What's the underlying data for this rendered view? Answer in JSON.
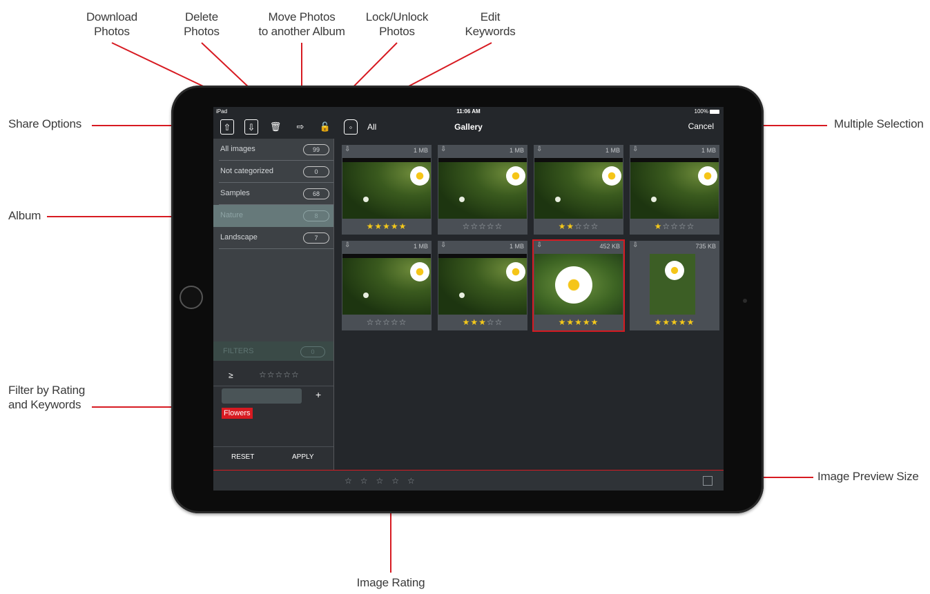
{
  "callouts": {
    "download": "Download\nPhotos",
    "delete": "Delete\nPhotos",
    "move": "Move Photos\nto another Album",
    "lock": "Lock/Unlock\nPhotos",
    "keywords": "Edit\nKeywords",
    "share": "Share Options",
    "album": "Album",
    "filter": "Filter by Rating\nand Keywords",
    "multiple": "Multiple Selection",
    "preview_size": "Image Preview Size",
    "rating": "Image Rating"
  },
  "colors": {
    "accent": "#d71a21",
    "star": "#f4c81b",
    "sidebar": "#3d4145",
    "screen": "#24272b"
  },
  "status": {
    "device": "iPad",
    "time": "11:06 AM",
    "battery": "100%"
  },
  "toolbar": {
    "icons": [
      "share-icon",
      "download-icon",
      "trash-icon",
      "move-arrow-icon",
      "lock-icon",
      "tag-icon"
    ],
    "all_label": "All",
    "title": "Gallery",
    "cancel_label": "Cancel"
  },
  "albums": [
    {
      "name": "All images",
      "count": "99"
    },
    {
      "name": "Not categorized",
      "count": "0"
    },
    {
      "name": "Samples",
      "count": "68"
    },
    {
      "name": "Nature",
      "count": "8",
      "selected": true
    },
    {
      "name": "Landscape",
      "count": "7"
    }
  ],
  "filters": {
    "title": "FILTERS",
    "count": "0",
    "operator": "≥",
    "rating_stars": "☆☆☆☆☆",
    "add_label": "+",
    "keyword_tag": "Flowers",
    "reset_label": "RESET",
    "apply_label": "APPLY"
  },
  "photos": [
    {
      "size": "1 MB",
      "rating": 5
    },
    {
      "size": "1 MB",
      "rating": 0
    },
    {
      "size": "1 MB",
      "rating": 2
    },
    {
      "size": "1 MB",
      "rating": 1
    },
    {
      "size": "1 MB",
      "rating": 0
    },
    {
      "size": "1 MB",
      "rating": 3
    },
    {
      "size": "452 KB",
      "rating": 5,
      "selected": true
    },
    {
      "size": "735 KB",
      "rating": 5
    }
  ],
  "bottombar": {
    "rating_stars": "☆☆☆☆☆"
  }
}
